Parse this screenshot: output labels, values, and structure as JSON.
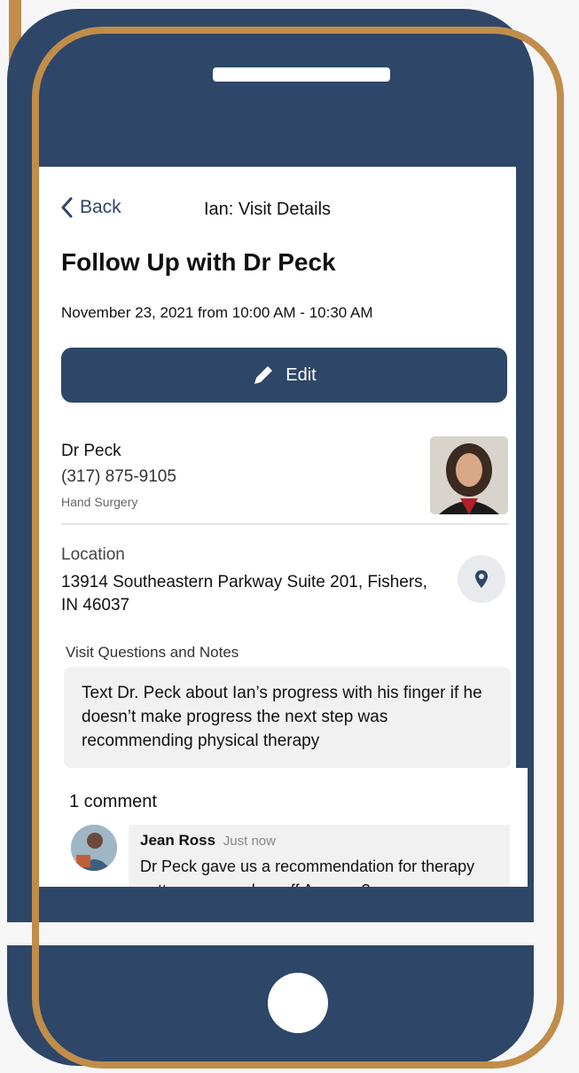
{
  "header": {
    "back_label": "Back",
    "title": "Ian: Visit Details"
  },
  "visit": {
    "title": "Follow Up with Dr Peck",
    "datetime": "November 23, 2021 from 10:00 AM - 10:30 AM",
    "edit_label": "Edit"
  },
  "doctor": {
    "name": "Dr Peck",
    "phone": "(317) 875-9105",
    "specialty": "Hand Surgery"
  },
  "location": {
    "label": "Location",
    "address": "13914 Southeastern Parkway Suite 201, Fishers, IN 46037"
  },
  "notes": {
    "label": "Visit Questions and Notes",
    "text": "Text Dr. Peck about Ian’s progress with his finger if he doesn’t make progress the next step was recommending physical therapy"
  },
  "comments": {
    "count_label": "1 comment",
    "items": [
      {
        "author": "Jean Ross",
        "time": "Just now",
        "text": "Dr Peck gave us a recommendation for therapy putty... can you buy off Amazon?"
      }
    ]
  },
  "colors": {
    "navy": "#2e4668",
    "gold": "#c08d4b"
  }
}
